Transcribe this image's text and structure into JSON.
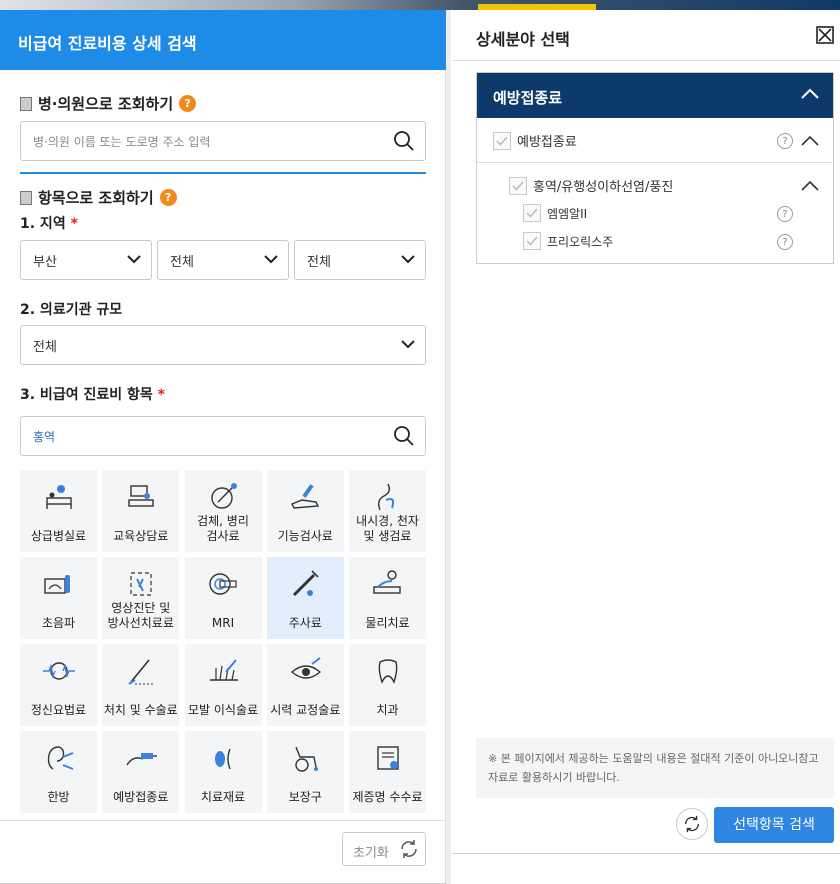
{
  "left": {
    "header_title": "비급여 진료비용 상세 검색",
    "hospital_section_title": "병·의원으로 조회하기",
    "help_glyph": "?",
    "hospital_search_placeholder": "병·의원 이름 또는 도로명 주소 입력",
    "item_section_title": "항목으로 조회하기",
    "region_label": "1. 지역",
    "required_mark": "*",
    "region_selects": [
      "부산",
      "전체",
      "전체"
    ],
    "size_label": "2. 의료기관 규모",
    "size_select": "전체",
    "item_label": "3. 비급여 진료비 항목",
    "item_search_value": "홍역",
    "tiles": [
      {
        "label": "상급병실료",
        "icon": "hospital-bed-icon"
      },
      {
        "label": "교육상담료",
        "icon": "counseling-desk-icon"
      },
      {
        "label": "검체, 병리\n검사료",
        "icon": "specimen-test-icon"
      },
      {
        "label": "기능검사료",
        "icon": "function-test-icon"
      },
      {
        "label": "내시경, 천자\n및 생검료",
        "icon": "endoscope-icon"
      },
      {
        "label": "초음파",
        "icon": "ultrasound-icon"
      },
      {
        "label": "영상진단 및\n방사선치료료",
        "icon": "radiology-icon"
      },
      {
        "label": "MRI",
        "icon": "mri-icon"
      },
      {
        "label": "주사료",
        "icon": "syringe-icon",
        "selected": true
      },
      {
        "label": "물리치료",
        "icon": "physical-therapy-icon"
      },
      {
        "label": "정신요법료",
        "icon": "brain-wave-icon"
      },
      {
        "label": "처치 및 수술료",
        "icon": "surgery-icon"
      },
      {
        "label": "모발 이식술료",
        "icon": "hair-transplant-icon"
      },
      {
        "label": "시력 교정술료",
        "icon": "eye-icon"
      },
      {
        "label": "치과",
        "icon": "tooth-icon"
      },
      {
        "label": "한방",
        "icon": "oriental-medicine-icon"
      },
      {
        "label": "예방접종료",
        "icon": "vaccination-icon"
      },
      {
        "label": "치료재료",
        "icon": "treatment-material-icon"
      },
      {
        "label": "보장구",
        "icon": "wheelchair-icon"
      },
      {
        "label": "제증명 수수료",
        "icon": "certificate-icon"
      }
    ],
    "reset_label": "초기화"
  },
  "right": {
    "title": "상세분야 선택",
    "category_header": "예방접종료",
    "level1": "예방접종료",
    "level2": "홍역/유행성이하선염/풍진",
    "level3": [
      "엠엠알II",
      "프리오릭스주"
    ],
    "q_glyph": "?",
    "note": "※ 본 페이지에서 제공하는 도움말의 내용은 절대적 기준이 아니오니참고자료로 활용하시기 바랍니다.",
    "search_button": "선택항목 검색"
  },
  "colors": {
    "primary_blue": "#1e8ce6",
    "navy": "#0d3a6a",
    "help_orange": "#f08a1c",
    "required_red": "#e02020",
    "button_blue": "#2f86e2"
  }
}
